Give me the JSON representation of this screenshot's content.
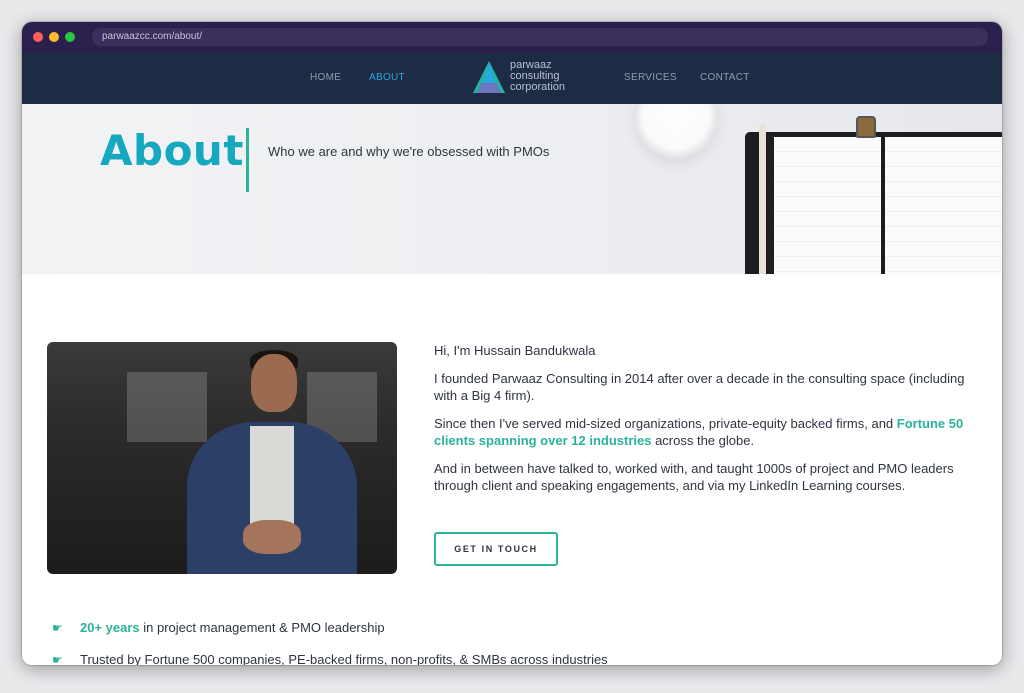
{
  "browser": {
    "url": "parwaazcc.com/about/"
  },
  "nav": {
    "items": [
      "HOME",
      "ABOUT",
      "SERVICES",
      "CONTACT"
    ],
    "active": "ABOUT",
    "logo_lines": [
      "parwaaz",
      "consulting",
      "corporation"
    ]
  },
  "hero": {
    "title": "About",
    "subtitle": "Who we are and why we're obsessed with PMOs"
  },
  "intro": {
    "greeting": "Hi, I'm Hussain Bandukwala",
    "p1": "I founded Parwaaz Consulting in 2014 after over a decade in the consulting space (including with a Big 4 firm).",
    "p2_before": "Since then I've served mid-sized organizations, private-equity backed firms, and ",
    "p2_highlight": "Fortune 50 clients spanning over 12 industries",
    "p2_after": " across the globe.",
    "p3": "And in between have talked to, worked with, and taught 1000s of project and PMO leaders through client and speaking engagements, and via my LinkedIn Learning courses.",
    "cta_label": "GET IN TOUCH"
  },
  "bullets": [
    {
      "icon": "pointing-hand-icon",
      "highlight": "20+ years",
      "text": " in project management & PMO leadership"
    },
    {
      "icon": "pointing-hand-icon",
      "highlight": "",
      "text": "Trusted by Fortune 500 companies, PE-backed firms, non-profits, & SMBs across industries"
    }
  ],
  "colors": {
    "accent": "#2bb39a",
    "title": "#16a8bf",
    "nav_bg": "#1e2b44",
    "nav_active": "#2aa7e0"
  }
}
